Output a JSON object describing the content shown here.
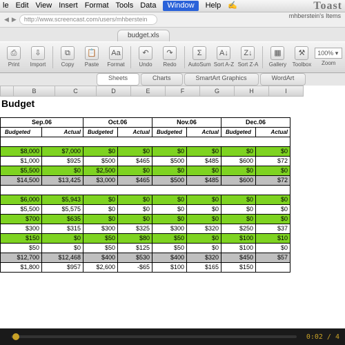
{
  "mac_menu": [
    "le",
    "Edit",
    "View",
    "Insert",
    "Format",
    "Tools",
    "Data",
    "Window",
    "Help"
  ],
  "mac_highlight_index": 7,
  "toast_label": "Toast",
  "owner_label": "mhberstein's Items",
  "url_fragment": "http://www.screencast.com/users/mhberstein",
  "sheet_tab": "budget.xls",
  "toolbar": [
    {
      "label": "Print",
      "glyph": "⎙"
    },
    {
      "label": "Import",
      "glyph": "⇩"
    },
    {
      "sep": true
    },
    {
      "label": "Copy",
      "glyph": "⧉"
    },
    {
      "label": "Paste",
      "glyph": "📋"
    },
    {
      "label": "Format",
      "glyph": "Aa"
    },
    {
      "sep": true
    },
    {
      "label": "Undo",
      "glyph": "↶"
    },
    {
      "label": "Redo",
      "glyph": "↷"
    },
    {
      "sep": true
    },
    {
      "label": "AutoSum",
      "glyph": "Σ"
    },
    {
      "label": "Sort A-Z",
      "glyph": "A↓"
    },
    {
      "label": "Sort Z-A",
      "glyph": "Z↓"
    },
    {
      "sep": true
    },
    {
      "label": "Gallery",
      "glyph": "▦"
    },
    {
      "label": "Toolbox",
      "glyph": "⚒"
    },
    {
      "label": "Zoom",
      "glyph": ""
    }
  ],
  "zoom_value": "100%",
  "subtabs": [
    "Sheets",
    "Charts",
    "SmartArt Graphics",
    "WordArt"
  ],
  "subtab_active": 0,
  "columns": [
    "B",
    "C",
    "D",
    "E",
    "F",
    "G",
    "H",
    "I"
  ],
  "budget_title": "Budget",
  "months": [
    {
      "name": "Sep.06",
      "col_b": "Budgeted",
      "col_a": "Actual"
    },
    {
      "name": "Oct.06",
      "col_b": "Budgeted",
      "col_a": "Actual"
    },
    {
      "name": "Nov.06",
      "col_b": "Budgeted",
      "col_a": "Actual"
    },
    {
      "name": "Dec.06",
      "col_b": "Budgeted",
      "col_a": "Actual"
    }
  ],
  "block1": [
    {
      "cls": "g",
      "cells": [
        "$8,000",
        "$7,000",
        "$0",
        "$0",
        "$0",
        "$0",
        "$0",
        "$0"
      ]
    },
    {
      "cls": "",
      "cells": [
        "$1,000",
        "$925",
        "$500",
        "$465",
        "$500",
        "$485",
        "$600",
        "$72"
      ]
    },
    {
      "cls": "g",
      "cells": [
        "$5,500",
        "$0",
        "$2,500",
        "$0",
        "$0",
        "$0",
        "$0",
        "$0"
      ]
    },
    {
      "cls": "gr",
      "cells": [
        "$14,500",
        "$13,425",
        "$3,000",
        "$465",
        "$500",
        "$485",
        "$600",
        "$72"
      ]
    }
  ],
  "block2": [
    {
      "cls": "g",
      "cells": [
        "$6,000",
        "$5,943",
        "$0",
        "$0",
        "$0",
        "$0",
        "$0",
        "$0"
      ]
    },
    {
      "cls": "",
      "cells": [
        "$5,500",
        "$5,575",
        "$0",
        "$0",
        "$0",
        "$0",
        "$0",
        "$0"
      ]
    },
    {
      "cls": "g",
      "cells": [
        "$700",
        "$635",
        "$0",
        "$0",
        "$0",
        "$0",
        "$0",
        "$0"
      ]
    },
    {
      "cls": "",
      "cells": [
        "$300",
        "$315",
        "$300",
        "$325",
        "$300",
        "$320",
        "$250",
        "$37"
      ]
    },
    {
      "cls": "g",
      "cells": [
        "$150",
        "$0",
        "$50",
        "$80",
        "$50",
        "$0",
        "$100",
        "$10"
      ]
    },
    {
      "cls": "",
      "cells": [
        "$50",
        "$0",
        "$50",
        "$125",
        "$50",
        "$0",
        "$100",
        "$0"
      ]
    },
    {
      "cls": "gr",
      "cells": [
        "$12,700",
        "$12,468",
        "$400",
        "$530",
        "$400",
        "$320",
        "$450",
        "$57"
      ]
    },
    {
      "cls": "",
      "cells": [
        "$1,800",
        "$957",
        "$2,600",
        "-$65",
        "$100",
        "$165",
        "$150",
        ""
      ]
    }
  ],
  "player_time": "0:02 / 4"
}
